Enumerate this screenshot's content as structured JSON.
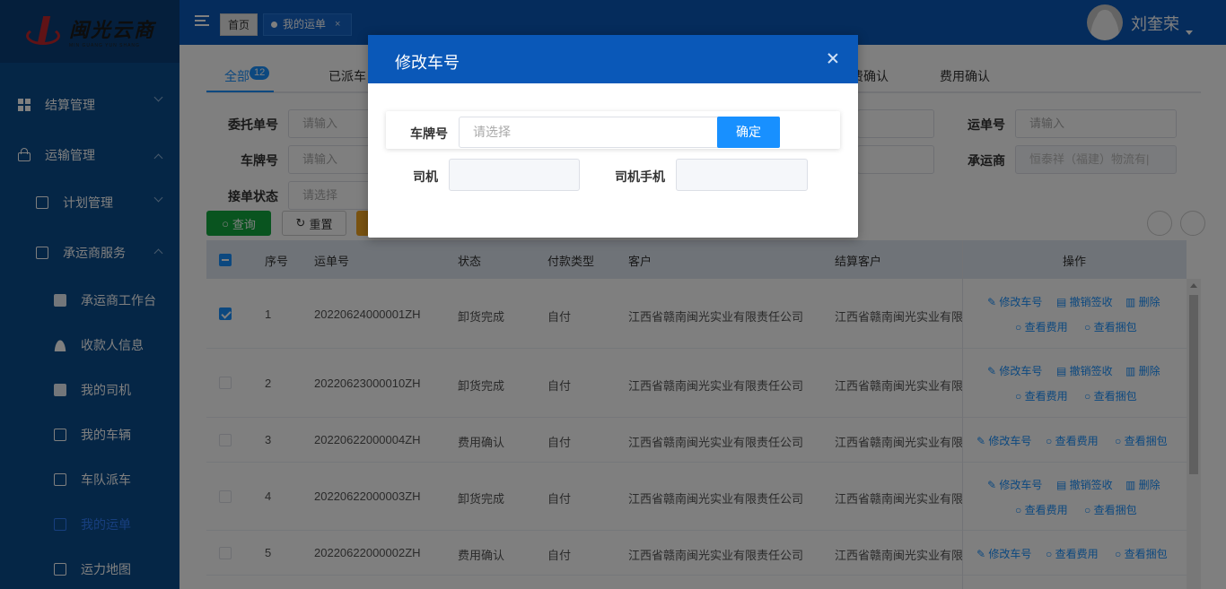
{
  "logo": {
    "cn": "闽光云商",
    "en": "MIN GUANG YUN SHANG"
  },
  "sidebar": {
    "items": [
      {
        "label": "结算管理",
        "level": 1,
        "icon": "grid-icon"
      },
      {
        "label": "运输管理",
        "level": 1,
        "icon": "lock-icon"
      },
      {
        "label": "计划管理",
        "level": 2,
        "icon": "briefcase-icon"
      },
      {
        "label": "承运商服务",
        "level": 2,
        "icon": "card-icon"
      },
      {
        "label": "承运商工作台",
        "level": 3,
        "icon": "calendar-icon"
      },
      {
        "label": "收款人信息",
        "level": 3,
        "icon": "users-icon"
      },
      {
        "label": "我的司机",
        "level": 3,
        "icon": "edit-doc-icon"
      },
      {
        "label": "我的车辆",
        "level": 3,
        "icon": "disc-icon"
      },
      {
        "label": "车队派车",
        "level": 3,
        "icon": "card-icon"
      },
      {
        "label": "我的运单",
        "level": 3,
        "icon": "checkbox-icon"
      },
      {
        "label": "运力地图",
        "level": 3,
        "icon": "disc-icon"
      }
    ]
  },
  "topbar": {
    "home_tag": "首页",
    "current_tag": "我的运单",
    "close": "×",
    "username": "刘奎荣"
  },
  "tabs": [
    {
      "label": "全部",
      "badge": "12"
    },
    {
      "label": "已派车"
    },
    {
      "label": "费确认"
    },
    {
      "label": "费用确认"
    }
  ],
  "filters": {
    "order_label": "委托单号",
    "order_placeholder": "请输入",
    "plate_label": "车牌号",
    "plate_placeholder": "请输入",
    "status_label": "接单状态",
    "status_placeholder": "请选择",
    "waybill_label": "运单号",
    "waybill_placeholder": "请输入",
    "carrier_label": "承运商",
    "carrier_value": "恒泰祥（福建）物流有|"
  },
  "buttons": {
    "query": "查询",
    "reset": "重置"
  },
  "table": {
    "headers": [
      "序号",
      "运单号",
      "状态",
      "付款类型",
      "客户",
      "结算客户",
      "操作"
    ],
    "rows": [
      {
        "no": "1",
        "waybill": "20220624000001ZH",
        "status": "卸货完成",
        "pay": "自付",
        "customer": "江西省赣南闽光实业有限责任公司",
        "settle": "江西省赣南闽光实业有限",
        "checked": true,
        "ops": [
          "修改车号",
          "撤销签收",
          "删除",
          "查看费用",
          "查看捆包"
        ]
      },
      {
        "no": "2",
        "waybill": "20220623000010ZH",
        "status": "卸货完成",
        "pay": "自付",
        "customer": "江西省赣南闽光实业有限责任公司",
        "settle": "江西省赣南闽光实业有限",
        "checked": false,
        "ops": [
          "修改车号",
          "撤销签收",
          "删除",
          "查看费用",
          "查看捆包"
        ]
      },
      {
        "no": "3",
        "waybill": "20220622000004ZH",
        "status": "费用确认",
        "pay": "自付",
        "customer": "江西省赣南闽光实业有限责任公司",
        "settle": "江西省赣南闽光实业有限",
        "checked": false,
        "ops": [
          "修改车号",
          "查看费用",
          "查看捆包"
        ]
      },
      {
        "no": "4",
        "waybill": "20220622000003ZH",
        "status": "卸货完成",
        "pay": "自付",
        "customer": "江西省赣南闽光实业有限责任公司",
        "settle": "江西省赣南闽光实业有限",
        "checked": false,
        "ops": [
          "修改车号",
          "撤销签收",
          "删除",
          "查看费用",
          "查看捆包"
        ]
      },
      {
        "no": "5",
        "waybill": "20220622000002ZH",
        "status": "费用确认",
        "pay": "自付",
        "customer": "江西省赣南闽光实业有限责任公司",
        "settle": "江西省赣南闽光实业有限",
        "checked": false,
        "ops": [
          "修改车号",
          "查看费用",
          "查看捆包"
        ]
      }
    ]
  },
  "modal": {
    "title": "修改车号",
    "plate_label": "车牌号",
    "plate_placeholder": "请选择",
    "confirm": "确定",
    "driver_label": "司机",
    "driver_phone_label": "司机手机"
  },
  "colors": {
    "sidebar": "#0b4c8c",
    "topbar": "#0a58b8",
    "accent": "#1890ff",
    "query": "#13a93f"
  }
}
